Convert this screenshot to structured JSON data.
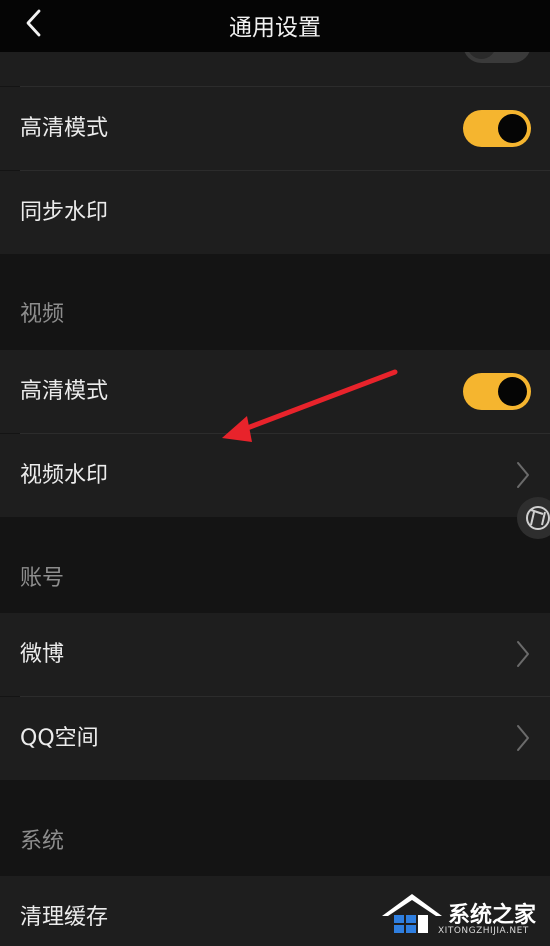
{
  "header": {
    "title": "通用设置"
  },
  "photo": {
    "hd_mode": {
      "label": "高清模式",
      "enabled": true
    },
    "sync_watermark": {
      "label": "同步水印"
    }
  },
  "video_section": {
    "title": "视频",
    "hd_mode": {
      "label": "高清模式",
      "enabled": true
    },
    "video_watermark": {
      "label": "视频水印"
    }
  },
  "account_section": {
    "title": "账号",
    "items": [
      {
        "label": "微博"
      },
      {
        "label": "QQ空间"
      }
    ]
  },
  "system_section": {
    "title": "系统",
    "clear_cache": {
      "label": "清理缓存"
    }
  },
  "watermark": {
    "name": "系统之家",
    "url": "XITONGZHIJIA.NET"
  },
  "colors": {
    "accent": "#f5b52f",
    "background": "#141414",
    "row": "#1e1e1e",
    "arrow": "#e8232b"
  }
}
